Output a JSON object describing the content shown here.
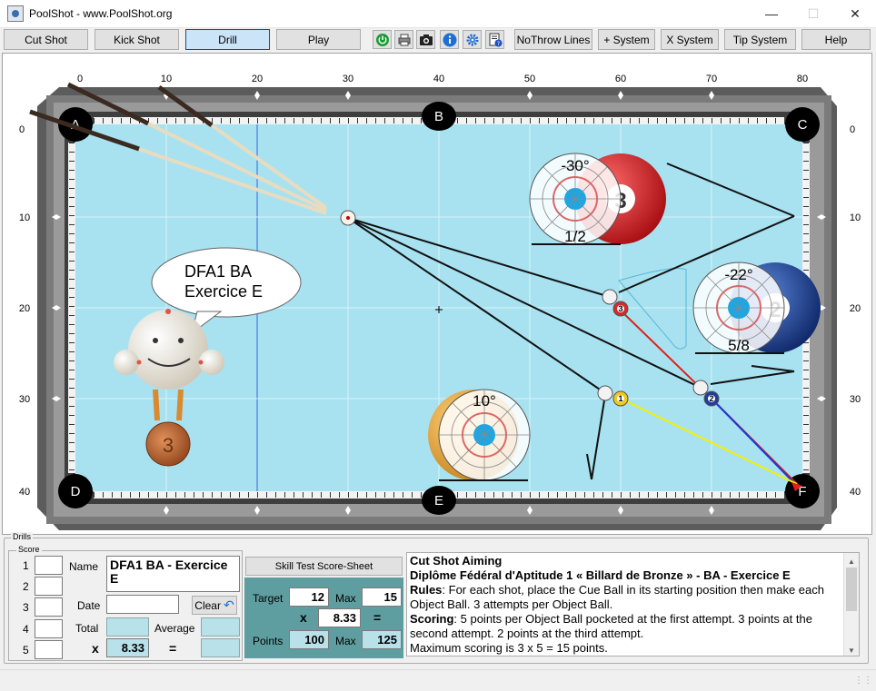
{
  "window": {
    "title": "PoolShot - www.PoolShot.org",
    "minimize_icon": "minimize-icon",
    "maximize_icon": "maximize-icon",
    "close_icon": "close-icon"
  },
  "toolbar": {
    "cut_shot": "Cut Shot",
    "kick_shot": "Kick Shot",
    "drill": "Drill",
    "play": "Play",
    "icons": [
      "power-icon",
      "print-icon",
      "camera-icon",
      "info-icon",
      "settings-gear-icon",
      "help-document-icon"
    ],
    "no_throw_lines": "NoThrow Lines",
    "plus_system": "+ System",
    "x_system": "X System",
    "tip_system": "Tip System",
    "help": "Help",
    "active_button": "Drill"
  },
  "table": {
    "top_ruler": [
      "0",
      "10",
      "20",
      "30",
      "40",
      "50",
      "60",
      "70",
      "80"
    ],
    "side_ruler": [
      "0",
      "10",
      "20",
      "30",
      "40"
    ],
    "pockets": [
      "A",
      "B",
      "C",
      "D",
      "E",
      "F"
    ],
    "colors": {
      "cloth": "#a9e3f1",
      "rail": "#6f6f6f",
      "red_line": "#e0201a",
      "blue_line": "#1a3ad8",
      "yellow_line": "#f4f000"
    },
    "balls": [
      {
        "number": "3",
        "color": "#d7282b"
      },
      {
        "number": "2",
        "color": "#1d3f9a"
      },
      {
        "number": "1",
        "color": "#f2c71d"
      }
    ],
    "aim_overlays": [
      {
        "angle": "-30°",
        "fraction": "1/2",
        "ball": "3"
      },
      {
        "angle": "-22°",
        "fraction": "5/8",
        "ball": "2"
      },
      {
        "angle": "10°",
        "fraction": "",
        "ball": "1"
      }
    ],
    "speech_bubble": {
      "line1": "DFA1 BA",
      "line2": "Exercice E"
    },
    "medal_number": "3"
  },
  "drills": {
    "group_title": "Drills",
    "score_title": "Score",
    "rows": [
      "1",
      "2",
      "3",
      "4",
      "5"
    ],
    "name_label": "Name",
    "name_value": "DFA1 BA - Exercice E",
    "date_label": "Date",
    "clear_button": "Clear",
    "total_label": "Total",
    "average_label": "Average",
    "x_symbol": "x",
    "multiplier": "8.33",
    "equals": "=",
    "skill_button": "Skill Test Score-Sheet",
    "target_label": "Target",
    "target_value": "12",
    "max_label": "Max",
    "max_value": "15",
    "teal_multiplier": "8.33",
    "points_label": "Points",
    "points_value": "100",
    "points_max_label": "Max",
    "points_max_value": "125"
  },
  "description": {
    "title": "Cut Shot Aiming",
    "subtitle": "Diplôme Fédéral d'Aptitude 1 « Billard de Bronze » - BA - Exercice E",
    "rules_label": "Rules",
    "rules_text": ": For each shot, place the Cue Ball in its starting position then make each Object Ball. 3 attempts per Object Ball.",
    "scoring_label": "Scoring",
    "scoring_text": ": 5 points per Object Ball pocketed at the first attempt. 3 points at the second attempt. 2 points at the third attempt.",
    "max_text": "Maximum scoring is 3 x 5 = 15 points."
  }
}
